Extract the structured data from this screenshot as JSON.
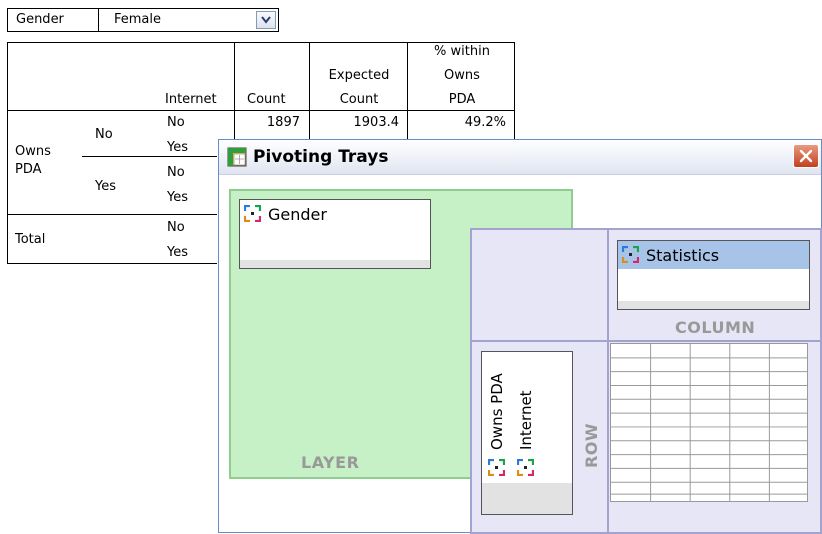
{
  "layer_bar": {
    "label": "Gender",
    "value": "Female"
  },
  "pivot_table": {
    "headers": {
      "internet": "Internet",
      "count": "Count",
      "expected_1": "Expected",
      "expected_2": "Count",
      "pct_1": "% within",
      "pct_2": "Owns",
      "pct_3": "PDA"
    },
    "row_group_1": "Owns",
    "row_group_2": "PDA",
    "sub_no": "No",
    "sub_yes": "Yes",
    "total": "Total",
    "rows": [
      {
        "internet": "No",
        "count": "1897",
        "expected": "1903.4",
        "pct": "49.2%"
      },
      {
        "internet": "Yes"
      },
      {
        "internet": "No"
      },
      {
        "internet": "Yes"
      },
      {
        "internet": "No"
      },
      {
        "internet": "Yes"
      }
    ]
  },
  "pivot_window": {
    "title": "Pivoting Trays",
    "layer_tray": {
      "caption": "LAYER",
      "items": [
        "Gender"
      ]
    },
    "column_tray": {
      "caption": "COLUMN",
      "items": [
        "Statistics"
      ]
    },
    "row_tray": {
      "caption": "ROW",
      "items": [
        "Owns PDA",
        "Internet"
      ]
    }
  },
  "colors": {
    "layer_tray_bg": "#c6f0c6",
    "row_col_tray_bg": "#e6e6f6",
    "selected_chip": "#a7c4e8",
    "close_button": "#c2401e"
  },
  "icons": [
    "dropdown-arrow-icon",
    "pivot-window-icon",
    "close-icon",
    "pivot-dimension-icon"
  ]
}
